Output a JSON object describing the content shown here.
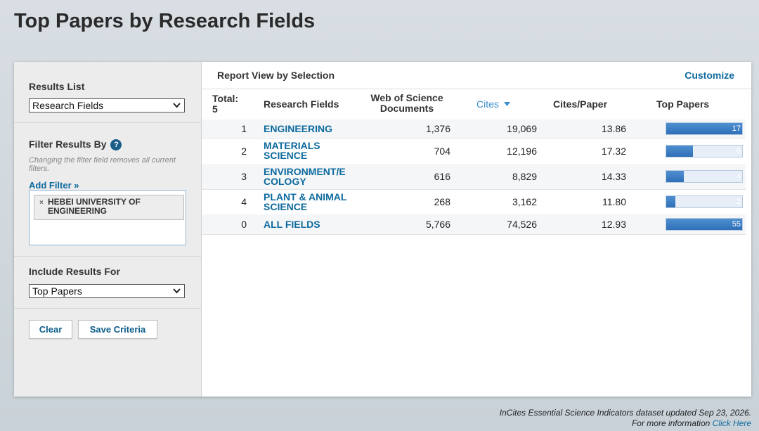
{
  "page": {
    "title": "Top Papers by Research Fields"
  },
  "sidebar": {
    "results_list": {
      "heading": "Results List",
      "selected": "Research Fields"
    },
    "filter": {
      "heading": "Filter Results By",
      "help": "?",
      "note": "Changing the filter field removes all current filters.",
      "add_filter": "Add Filter »",
      "chips": [
        {
          "remove": "×",
          "label": "HEBEI UNIVERSITY OF ENGINEERING"
        }
      ]
    },
    "include": {
      "heading": "Include Results For",
      "selected": "Top Papers"
    },
    "buttons": {
      "clear": "Clear",
      "save": "Save Criteria"
    }
  },
  "report": {
    "title": "Report View by Selection",
    "customize": "Customize",
    "headers": {
      "total": "Total:",
      "total_count": "5",
      "field": "Research Fields",
      "docs": "Web of Science Documents",
      "cites": "Cites",
      "cites_per_paper": "Cites/Paper",
      "top_papers": "Top Papers"
    },
    "rows": [
      {
        "rank": "1",
        "field": "ENGINEERING",
        "docs": "1,376",
        "cites": "19,069",
        "cpp": "13.86",
        "top_label": "17",
        "top_value": 17
      },
      {
        "rank": "2",
        "field": "MATERIALS SCIENCE",
        "docs": "704",
        "cites": "12,196",
        "cpp": "17.32",
        "top_label": "6",
        "top_value": 6
      },
      {
        "rank": "3",
        "field": "ENVIRONMENT/E COLOGY",
        "docs": "616",
        "cites": "8,829",
        "cpp": "14.33",
        "top_label": "4",
        "top_value": 4
      },
      {
        "rank": "4",
        "field": "PLANT & ANIMAL SCIENCE",
        "docs": "268",
        "cites": "3,162",
        "cpp": "11.80",
        "top_label": "2",
        "top_value": 2
      },
      {
        "rank": "0",
        "field": "ALL FIELDS",
        "docs": "5,766",
        "cites": "74,526",
        "cpp": "12.93",
        "top_label": "55",
        "top_value": 55
      }
    ],
    "max_top": 17
  },
  "footer": {
    "line1": "InCites Essential Science Indicators dataset updated Sep 23, 2026.",
    "line2": "For more information",
    "link": "Click Here"
  },
  "colors": {
    "accent": "#0d6a9e",
    "bar": "#2f6fb8",
    "sorted_header": "#3b8ecb"
  }
}
